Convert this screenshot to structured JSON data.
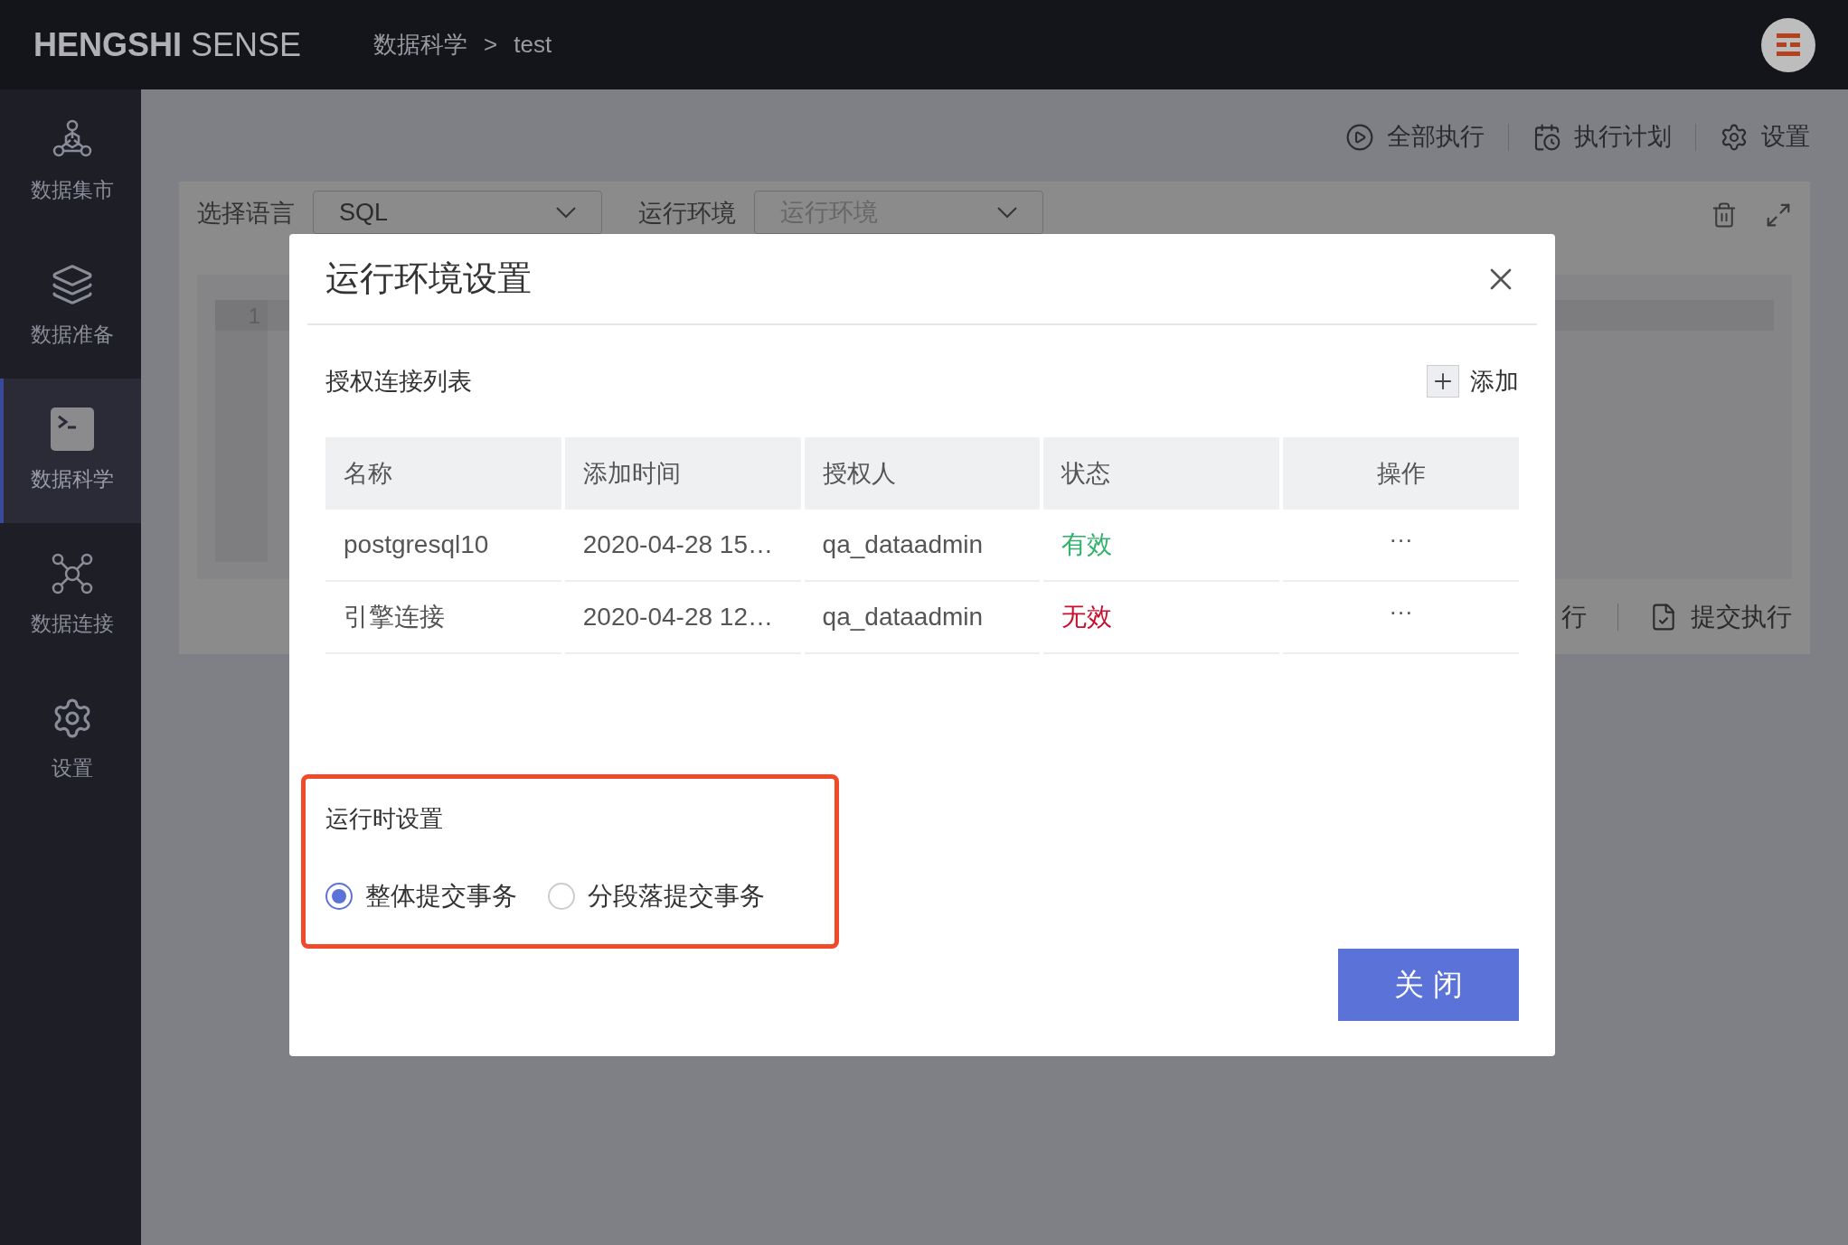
{
  "topbar": {
    "logo_bold": "HENGSHI",
    "logo_light": "SENSE",
    "breadcrumb": {
      "items": [
        "数据科学",
        "test"
      ],
      "separator": ">"
    }
  },
  "sidebar": {
    "items": [
      {
        "label": "数据集市",
        "selected": false
      },
      {
        "label": "数据准备",
        "selected": false
      },
      {
        "label": "数据科学",
        "selected": true
      },
      {
        "label": "数据连接",
        "selected": false
      },
      {
        "label": "设置",
        "selected": false
      }
    ]
  },
  "toolbar": [
    "全部执行",
    "执行计划",
    "设置"
  ],
  "editor": {
    "language_label": "选择语言",
    "language_value": "SQL",
    "env_label": "运行环境",
    "env_placeholder": "运行环境",
    "line_numbers": [
      "1"
    ],
    "footer_actions": [
      "行",
      "提交执行"
    ]
  },
  "dialog": {
    "title": "运行环境设置",
    "section_title": "授权连接列表",
    "add_label": "添加",
    "table": {
      "columns": [
        "名称",
        "添加时间",
        "授权人",
        "状态",
        "操作"
      ],
      "rows": [
        {
          "name": "postgresql10",
          "added": "2020-04-28 15…",
          "owner": "qa_dataadmin",
          "status": {
            "text": "有效",
            "color": "#2fb36b"
          },
          "action": "···"
        },
        {
          "name": "引擎连接",
          "added": "2020-04-28 12…",
          "owner": "qa_dataadmin",
          "status": {
            "text": "无效",
            "color": "#c8102e"
          },
          "action": "···"
        }
      ]
    },
    "runtime": {
      "title": "运行时设置",
      "options": [
        {
          "label": "整体提交事务",
          "selected": true
        },
        {
          "label": "分段落提交事务",
          "selected": false
        }
      ]
    },
    "close_label": "关 闭"
  }
}
